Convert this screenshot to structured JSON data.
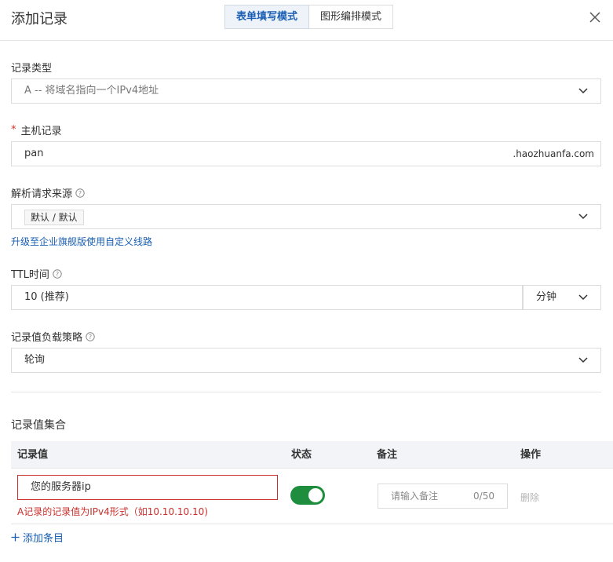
{
  "dialog": {
    "title": "添加记录",
    "tabs": [
      {
        "label": "表单填写模式",
        "active": true
      },
      {
        "label": "图形编排模式",
        "active": false
      }
    ]
  },
  "record_type": {
    "label": "记录类型",
    "value": "A -- 将域名指向一个IPv4地址"
  },
  "host_record": {
    "required_mark": "*",
    "label": "主机记录",
    "value": "pan",
    "suffix": ".haozhuanfa.com"
  },
  "resolve_source": {
    "label": "解析请求来源",
    "tag": "默认 / 默认",
    "upgrade_link": "升级至企业旗舰版使用自定义线路"
  },
  "ttl": {
    "label": "TTL时间",
    "value": "10 (推荐)",
    "unit": "分钟"
  },
  "load_strategy": {
    "label": "记录值负载策略",
    "value": "轮询"
  },
  "record_set": {
    "title": "记录值集合",
    "columns": [
      "记录值",
      "状态",
      "备注",
      "操作"
    ],
    "rows": [
      {
        "value": "您的服务器ip",
        "error": "A记录的记录值为IPv4形式（如10.10.10.10)",
        "status_on": true,
        "remark_placeholder": "请输入备注",
        "remark_count": "0/50",
        "action": "删除"
      }
    ],
    "add_label": "添加条目"
  },
  "colors": {
    "accent": "#1a5fb4",
    "toggle_on": "#1e8e3e",
    "error": "#c9302c"
  }
}
